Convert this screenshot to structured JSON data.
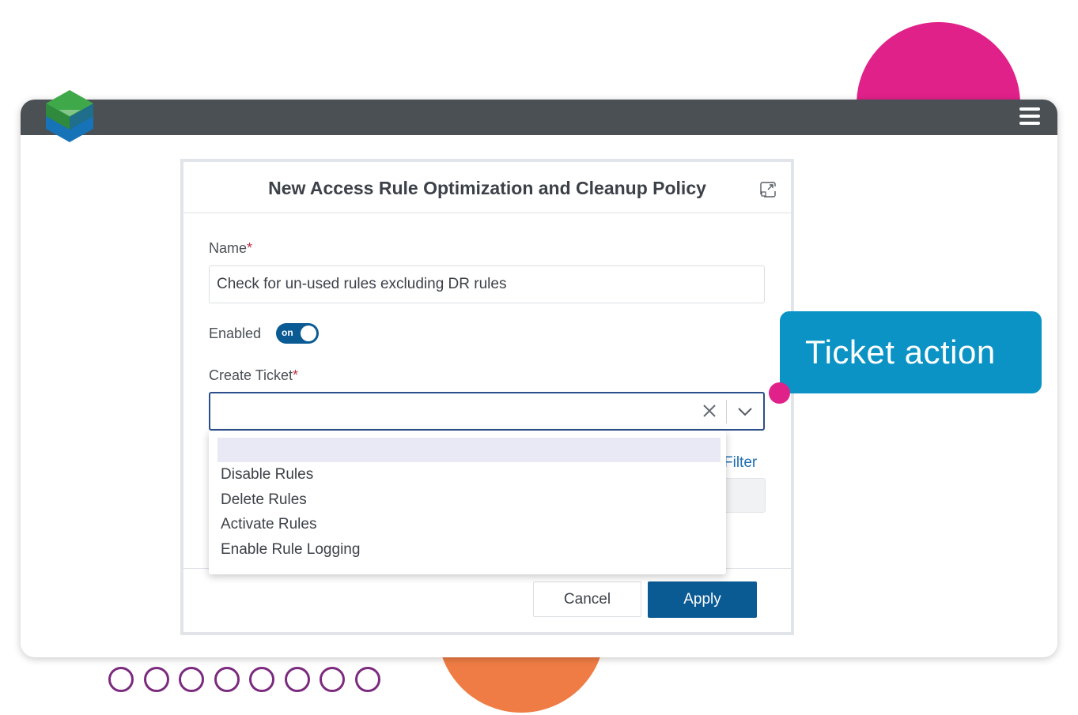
{
  "colors": {
    "accent_pink": "#e0218a",
    "accent_orange": "#f07c45",
    "topbar": "#4a5054",
    "primary_button": "#0a5a94",
    "callout": "#0a93c4",
    "rings": "#7b2a7e"
  },
  "topbar": {
    "menu_icon": "hamburger-menu-icon",
    "logo_icon": "cube-logo-icon"
  },
  "dialog": {
    "title": "New Access Rule Optimization and Cleanup Policy",
    "expand_icon": "expand-window-icon",
    "name": {
      "label": "Name",
      "required_mark": "*",
      "value": "Check for un-used rules excluding DR rules"
    },
    "enabled": {
      "label": "Enabled",
      "toggle_text": "on",
      "state": true
    },
    "create_ticket": {
      "label": "Create Ticket",
      "required_mark": "*",
      "value": "",
      "clear_icon": "close-icon",
      "chevron_icon": "chevron-down-icon"
    },
    "partially_hidden_link": "Filter",
    "footer": {
      "cancel": "Cancel",
      "apply": "Apply"
    }
  },
  "dropdown": {
    "options": [
      "",
      "Disable Rules",
      "Delete Rules",
      "Activate Rules",
      "Enable Rule Logging"
    ],
    "highlighted_index": 0
  },
  "callout": {
    "text": "Ticket action"
  }
}
